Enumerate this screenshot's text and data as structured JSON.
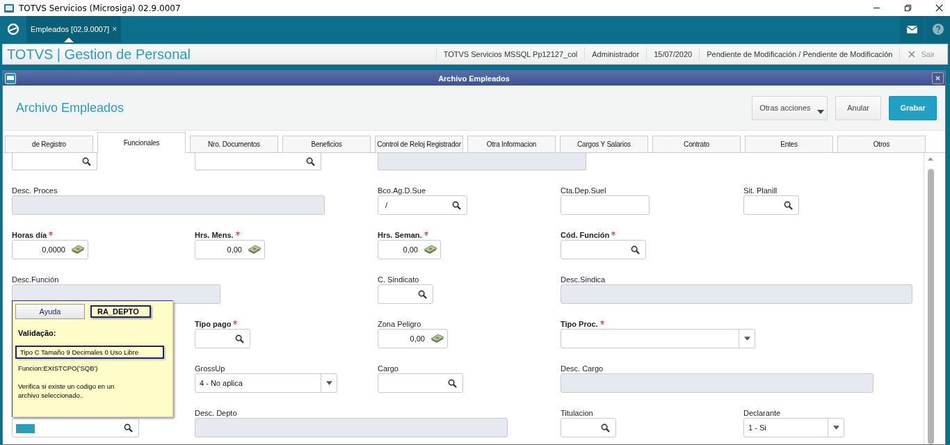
{
  "os_window": {
    "title": "TOTVS Servicios (Microsiga) 02.9.0007"
  },
  "app_tabs": [
    {
      "label": "Empleados [02.9.0007]",
      "close": "×",
      "selected": true
    }
  ],
  "header": {
    "title": "TOTVS | Gestion de Personal",
    "info": [
      "TOTVS Servicios MSSQL Pp12127_col",
      "Administrador",
      "15/07/2020",
      "Pendiente de Modificación / Pendiente de Modificación"
    ],
    "exit": "Sair"
  },
  "dialog": {
    "title": "Archivo Empleados",
    "heading": "Archivo Empleados",
    "buttons": [
      {
        "label": "Otras acciones",
        "kind": "menu"
      },
      {
        "label": "Anular",
        "kind": "plain"
      },
      {
        "label": "Grabar",
        "kind": "primary"
      }
    ],
    "tabs": [
      {
        "label": "de Registro",
        "selected": false
      },
      {
        "label": "Funcionales",
        "selected": true
      },
      {
        "label": "Nro. Documentos",
        "selected": false
      },
      {
        "label": "Beneficios",
        "selected": false
      },
      {
        "label": "Control de Reloj Registrador",
        "selected": false
      },
      {
        "label": "Otra Informacion",
        "selected": false
      },
      {
        "label": "Cargos Y Salarios",
        "selected": false
      },
      {
        "label": "Contrato",
        "selected": false
      },
      {
        "label": "Entes",
        "selected": false
      },
      {
        "label": "Otros",
        "selected": false
      }
    ],
    "rows": [
      [
        {
          "kind": "lookup"
        },
        {
          "kind": "lookup"
        },
        {
          "kind": "readonly"
        }
      ],
      [
        {
          "label": "Desc. Proces",
          "kind": "readonly"
        },
        "",
        {
          "label": "Bco.Ag.D.Sue",
          "kind": "lookup",
          "value": "/"
        },
        {
          "label": "Cta.Dep.Suel",
          "kind": "text"
        },
        {
          "label": "Sit. Planill",
          "kind": "lookup"
        }
      ],
      [
        {
          "label": "Horas día",
          "required": true,
          "kind": "number",
          "value": "0,0000"
        },
        {
          "label": "Hrs. Mens.",
          "required": true,
          "kind": "number",
          "value": "0,00"
        },
        {
          "label": "Hrs. Seman.",
          "required": true,
          "kind": "number",
          "value": "0,00"
        },
        {
          "label": "Cód. Función",
          "required": true,
          "kind": "lookup"
        }
      ],
      [
        {
          "label": "Desc.Función",
          "kind": "readonly"
        },
        "",
        {
          "label": "C. Sindicato",
          "kind": "lookup"
        },
        {
          "label": "Desc.Sindica",
          "kind": "readonly"
        }
      ],
      [
        "",
        {
          "label": "Tipo pago",
          "required": true,
          "kind": "lookup"
        },
        {
          "label": "Zona Peligro",
          "kind": "number",
          "value": "0,00"
        },
        {
          "label": "Tipo Proc.",
          "required": true,
          "kind": "select"
        }
      ],
      [
        "",
        {
          "label": "GrossUp",
          "kind": "select",
          "value": "4 - No aplica"
        },
        {
          "label": "Cargo",
          "kind": "lookup"
        },
        {
          "label": "Desc. Cargo",
          "kind": "readonly"
        }
      ],
      [
        {
          "kind": "lookup",
          "focused": true
        },
        {
          "label": "Desc. Depto",
          "kind": "readonly"
        },
        "",
        {
          "label": "Titulacion",
          "kind": "lookup"
        },
        {
          "label": "Declarante",
          "kind": "select",
          "value": "1 - Si"
        }
      ]
    ],
    "help_popup": {
      "button": "Ayuda",
      "field_name": "RA_DEPTO",
      "heading": "Validação:",
      "type_info": "Tipo C Tamaño   9 Decimales 0  Uso Libre",
      "function": "Funcion:EXISTCPO('SQB')",
      "description": "Verifica si existe un codigo en un archivo seleccionado.."
    }
  }
}
